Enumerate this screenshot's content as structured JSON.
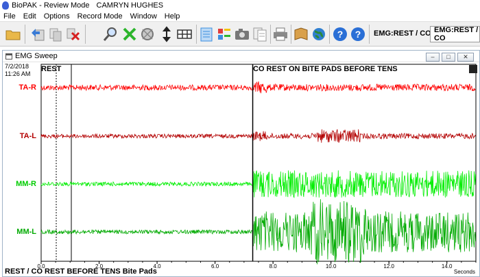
{
  "app": {
    "title": "BioPAK - Review Mode",
    "user": "CAMRYN HUGHES"
  },
  "menu": [
    "File",
    "Edit",
    "Options",
    "Record Mode",
    "Window",
    "Help"
  ],
  "toolbar": {
    "buttons": [
      {
        "name": "open-folder-icon",
        "color": "#e9b84a"
      },
      {
        "name": "back-arrow-icon",
        "color": "#3a7bd5"
      },
      {
        "name": "copy-icon",
        "color": "#b8b8b8"
      },
      {
        "name": "delete-icon",
        "color": "#d62020"
      },
      {
        "name": "magnifier-icon",
        "color": "#666666"
      },
      {
        "name": "green-x-icon",
        "color": "#2db52d"
      },
      {
        "name": "globe-gray-icon",
        "color": "#888888"
      },
      {
        "name": "vertical-arrows-icon",
        "color": "#222222"
      },
      {
        "name": "grid-icon",
        "color": "#333333"
      },
      {
        "name": "notepad-icon",
        "color": "#3c8ee0"
      },
      {
        "name": "colors-icon",
        "color": "#e03c3c"
      },
      {
        "name": "camera-icon",
        "color": "#555555"
      },
      {
        "name": "documents-icon",
        "color": "#999999"
      },
      {
        "name": "printer-icon",
        "color": "#6a6a6a"
      },
      {
        "name": "book-icon",
        "color": "#d9a04a"
      },
      {
        "name": "globe-icon",
        "color": "#2a8a3a"
      },
      {
        "name": "help-icon",
        "color": "#2a6fd6"
      },
      {
        "name": "help-context-icon",
        "color": "#2a6fd6"
      }
    ],
    "mode_label": "EMG:REST / CO",
    "mode_box": "EMG:REST / CO"
  },
  "emg_window": {
    "title": "EMG Sweep",
    "date": "7/2/2018",
    "time": "11:26 AM",
    "segments": [
      "REST",
      "CO REST ON BITE PADS BEFORE TENS"
    ],
    "footer": "REST / CO REST BEFORE TENS Bite Pads",
    "x_unit": "Seconds",
    "x_ticks": [
      "0.0",
      "2.0",
      "4.0",
      "6.0",
      "8.0",
      "10.0",
      "12.0",
      "14.0"
    ]
  },
  "chart_data": {
    "type": "line",
    "xlabel": "Seconds",
    "xlim": [
      0,
      15
    ],
    "x_ticks": [
      0,
      2,
      4,
      6,
      8,
      10,
      12,
      14
    ],
    "markers": [
      {
        "label": "REST",
        "x": 0
      },
      {
        "label": "CO REST ON BITE PADS BEFORE TENS",
        "x": 7.3
      }
    ],
    "series": [
      {
        "name": "TA-R",
        "color": "#ff0000",
        "baseline_amplitude": 4,
        "segment2_amplitude": 5
      },
      {
        "name": "TA-L",
        "color": "#b30000",
        "baseline_amplitude": 3,
        "segment2_amplitude": 4
      },
      {
        "name": "MM-R",
        "color": "#00ee00",
        "baseline_amplitude": 3,
        "segment2_amplitude": 20
      },
      {
        "name": "MM-L",
        "color": "#00aa00",
        "baseline_amplitude": 3,
        "segment2_amplitude": 30
      }
    ]
  }
}
